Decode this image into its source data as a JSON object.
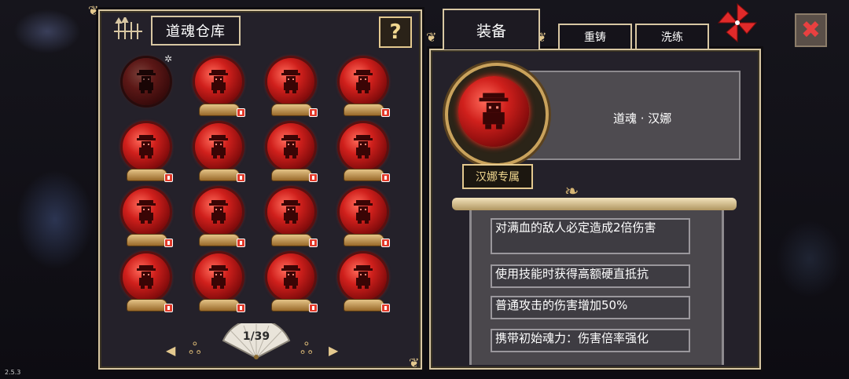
{
  "version": "2.5.3",
  "warehouse": {
    "title": "道魂仓库",
    "help_label": "?",
    "page_indicator": "1/39",
    "prev_label": "◀",
    "next_label": "▶",
    "slots": [
      {
        "state": "selected",
        "starred": true,
        "badge": false
      },
      {
        "state": "normal",
        "starred": false,
        "badge": true
      },
      {
        "state": "normal",
        "starred": false,
        "badge": true
      },
      {
        "state": "normal",
        "starred": false,
        "badge": true
      },
      {
        "state": "normal",
        "starred": false,
        "badge": true
      },
      {
        "state": "normal",
        "starred": false,
        "badge": true
      },
      {
        "state": "normal",
        "starred": false,
        "badge": true
      },
      {
        "state": "normal",
        "starred": false,
        "badge": true
      },
      {
        "state": "normal",
        "starred": false,
        "badge": true
      },
      {
        "state": "normal",
        "starred": false,
        "badge": true
      },
      {
        "state": "normal",
        "starred": false,
        "badge": true
      },
      {
        "state": "normal",
        "starred": false,
        "badge": true
      },
      {
        "state": "normal",
        "starred": false,
        "badge": true
      },
      {
        "state": "normal",
        "starred": false,
        "badge": true
      },
      {
        "state": "normal",
        "starred": false,
        "badge": true
      },
      {
        "state": "normal",
        "starred": false,
        "badge": true
      }
    ]
  },
  "tabs": {
    "equip": "装备",
    "reforge": "重铸",
    "refine": "洗练"
  },
  "close_label": "✖",
  "item": {
    "name": "道魂 · 汉娜",
    "exclusive_tag": "汉娜专属",
    "effects": [
      "对满血的敌人必定造成2倍伤害",
      "使用技能时获得高额硬直抵抗",
      "普通攻击的伤害增加50%",
      "携带初始魂力：伤害倍率强化"
    ]
  },
  "colors": {
    "panel_border": "#d8c7a3",
    "gold": "#e4c98f",
    "orb_red": "#d0201c",
    "panel_bg": "#24212a"
  }
}
